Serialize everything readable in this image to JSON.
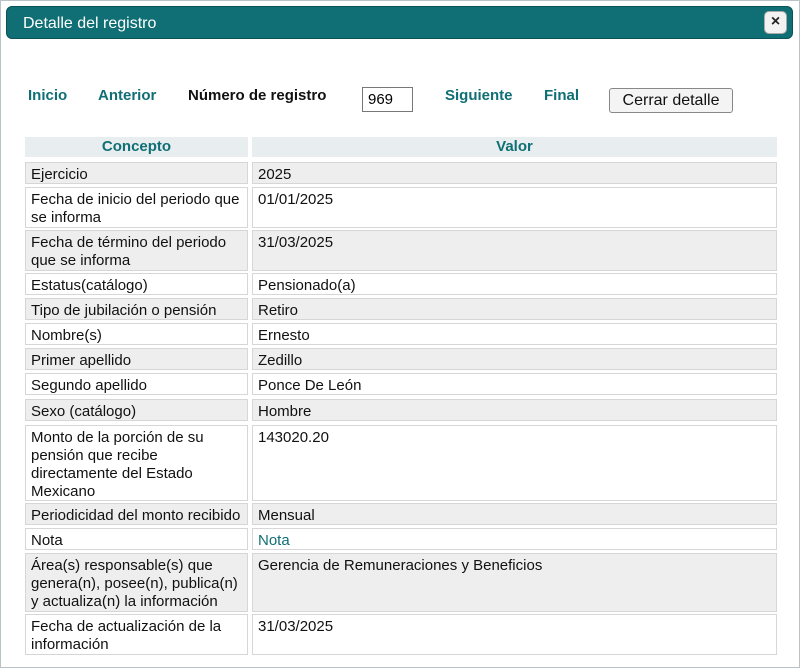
{
  "dialog": {
    "title": "Detalle del registro",
    "close_icon": "×"
  },
  "nav": {
    "inicio": "Inicio",
    "anterior": "Anterior",
    "record_label": "Número de registro",
    "record_value": "969",
    "siguiente": "Siguiente",
    "final": "Final",
    "close_detail": "Cerrar detalle"
  },
  "table": {
    "headers": {
      "concepto": "Concepto",
      "valor": "Valor"
    },
    "rows": [
      {
        "concepto": "Ejercicio",
        "valor": "2025"
      },
      {
        "concepto": "Fecha de inicio del periodo que se informa",
        "valor": "01/01/2025"
      },
      {
        "concepto": "Fecha de término del periodo que se informa",
        "valor": "31/03/2025"
      },
      {
        "concepto": "Estatus(catálogo)",
        "valor": "Pensionado(a)"
      },
      {
        "concepto": "Tipo de jubilación o pensión",
        "valor": "Retiro"
      },
      {
        "concepto": "Nombre(s)",
        "valor": "Ernesto"
      },
      {
        "concepto": "Primer apellido",
        "valor": "Zedillo"
      },
      {
        "concepto": "Segundo apellido",
        "valor": "Ponce De León"
      },
      {
        "concepto": "Sexo (catálogo)",
        "valor": "Hombre"
      },
      {
        "concepto": "Monto de la porción de su pensión que recibe directamente del Estado Mexicano",
        "valor": "143020.20"
      },
      {
        "concepto": "Periodicidad del monto recibido",
        "valor": "Mensual"
      },
      {
        "concepto": "Nota",
        "valor": "Nota"
      },
      {
        "concepto": "Área(s) responsable(s) que genera(n), posee(n), publica(n) y actualiza(n) la información",
        "valor": "Gerencia de Remuneraciones y Beneficios"
      },
      {
        "concepto": "Fecha de actualización de la información",
        "valor": "31/03/2025"
      }
    ]
  },
  "colors": {
    "accent": "#0f6f74",
    "header_bg": "#e8eef0",
    "row_gray": "#eeeeee"
  }
}
